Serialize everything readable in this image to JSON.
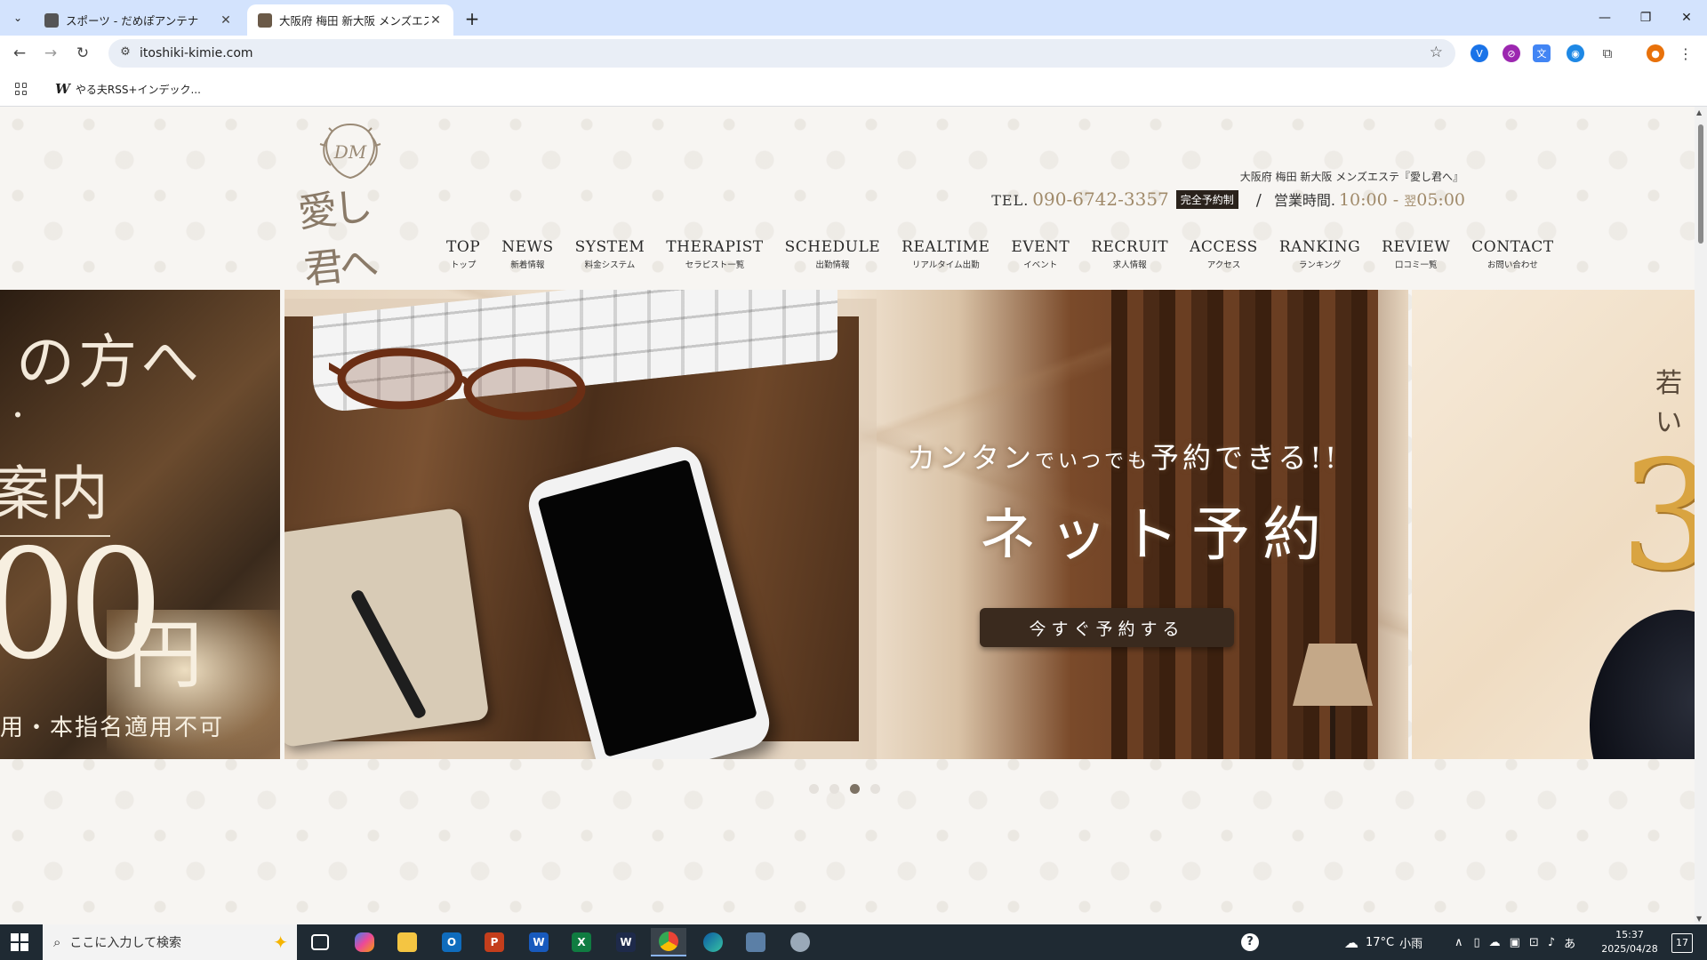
{
  "browser": {
    "tabs": [
      {
        "title": "スポーツ - だめぽアンテナ",
        "favicon_color": "#555555"
      },
      {
        "title": "大阪府 梅田 新大阪 メンズエステ「",
        "favicon_color": "#6b5a48"
      }
    ],
    "new_tab": "+",
    "url": "itoshiki-kimie.com",
    "bookmark": "やる夫RSS+インデック...",
    "window_controls": {
      "minimize": "—",
      "restore": "❐",
      "close": "✕"
    }
  },
  "site": {
    "logo_text": "愛し君へ",
    "logo_monogram": "DM",
    "tagline": "大阪府 梅田 新大阪 メンズエステ『愛し君へ』",
    "tel_label": "TEL.",
    "tel_number": "090-6742-3357",
    "reservation_badge": "完全予約制",
    "separator": "/",
    "hours_label": "営業時間.",
    "hours_start": "10:00",
    "hours_dash": " - ",
    "hours_next": "翌",
    "hours_end": "05:00",
    "nav": [
      {
        "en": "TOP",
        "jp": "トップ"
      },
      {
        "en": "NEWS",
        "jp": "新着情報"
      },
      {
        "en": "SYSTEM",
        "jp": "料金システム"
      },
      {
        "en": "THERAPIST",
        "jp": "セラピスト一覧"
      },
      {
        "en": "SCHEDULE",
        "jp": "出勤情報"
      },
      {
        "en": "REALTIME",
        "jp": "リアルタイム出勤"
      },
      {
        "en": "EVENT",
        "jp": "イベント"
      },
      {
        "en": "RECRUIT",
        "jp": "求人情報"
      },
      {
        "en": "ACCESS",
        "jp": "アクセス"
      },
      {
        "en": "RANKING",
        "jp": "ランキング"
      },
      {
        "en": "REVIEW",
        "jp": "口コミ一覧"
      },
      {
        "en": "CONTACT",
        "jp": "お問い合わせ"
      }
    ],
    "slides": {
      "left": {
        "line1": "の方へ",
        "dot": "・",
        "line2": "案内",
        "price": "00",
        "yen": "円",
        "note": "用・本指名適用不可"
      },
      "main": {
        "sub_a": "カンタン",
        "sub_b": "で",
        "sub_c": "いつでも",
        "sub_d": "予約できる!!",
        "title": "ネット予約",
        "button": "今すぐ予約する"
      },
      "right": {
        "text": "若い",
        "number": "3"
      }
    },
    "slider_dots": 4,
    "active_dot": 3
  },
  "taskbar": {
    "search_placeholder": "ここに入力して検索",
    "weather_temp": "17°C",
    "weather_text": "小雨",
    "ime": "あ",
    "time": "15:37",
    "date": "2025/04/28",
    "notifications": "17"
  }
}
